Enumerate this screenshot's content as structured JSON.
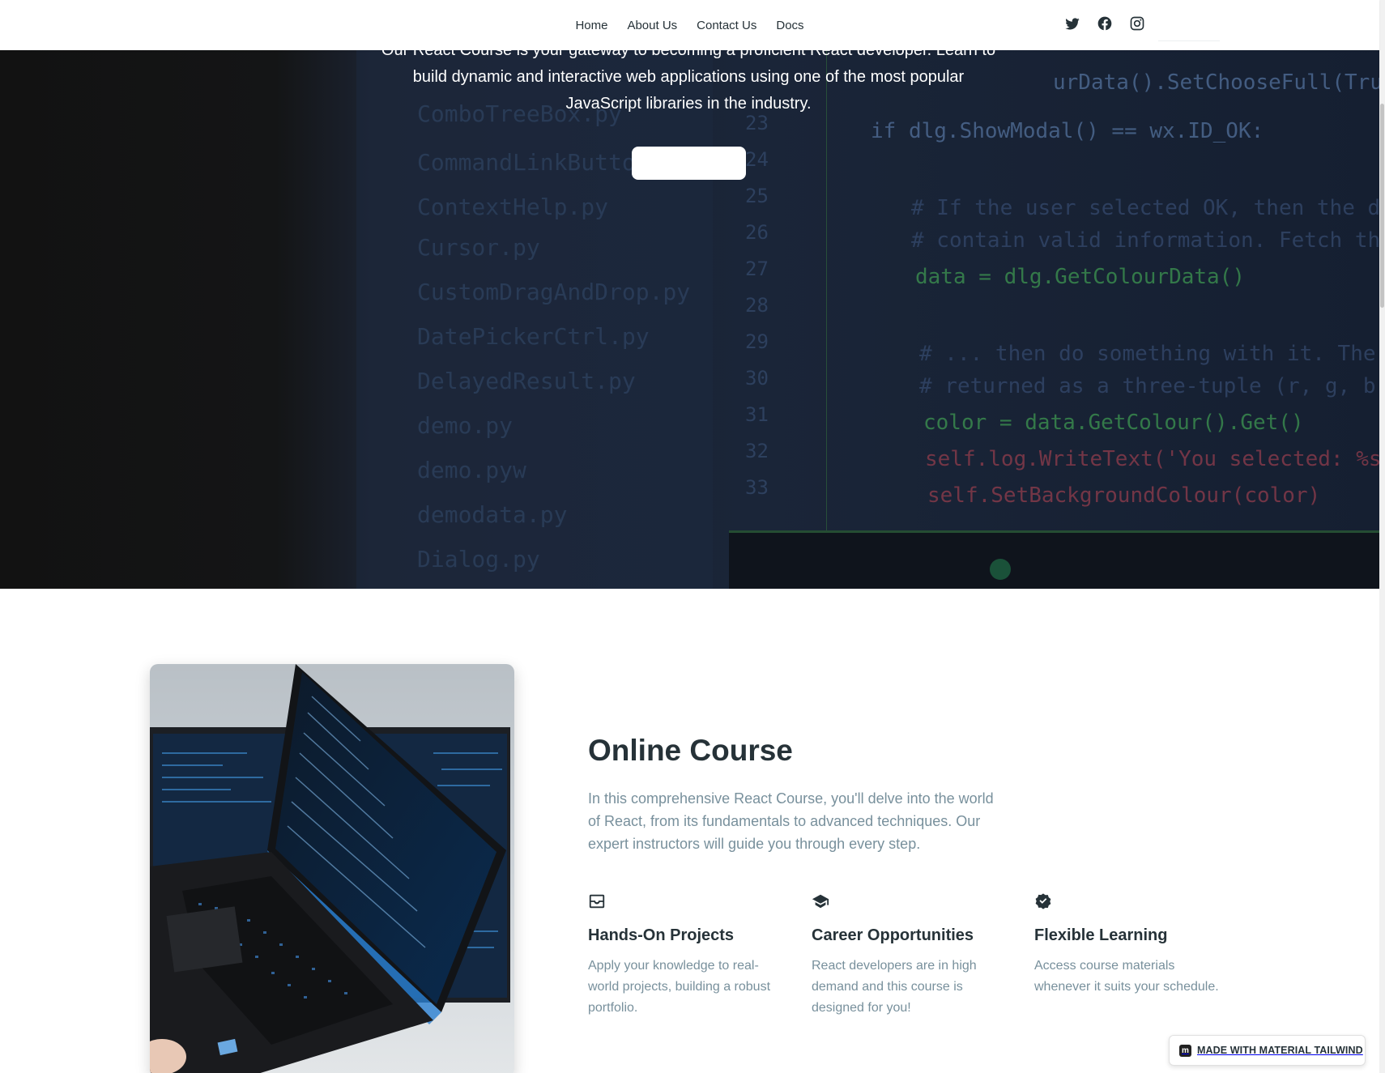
{
  "nav": {
    "links": [
      "Home",
      "About Us",
      "Contact Us",
      "Docs"
    ],
    "social_icons": [
      "twitter-icon",
      "facebook-icon",
      "instagram-icon"
    ]
  },
  "hero": {
    "lines": [
      "Our React Course is your gateway to becoming a proficient React developer. Learn to",
      "build dynamic and interactive web applications using one of the most popular",
      "JavaScript libraries in the industry."
    ],
    "button_label": ""
  },
  "course": {
    "title": "Online Course",
    "description": "In this comprehensive React Course, you'll delve into the world of React, from its fundamentals to advanced techniques. Our expert instructors will guide you through every step.",
    "features": [
      {
        "icon": "inbox-icon",
        "title": "Hands-On Projects",
        "description": "Apply your knowledge to real-world projects, building a robust portfolio."
      },
      {
        "icon": "graduation-cap-icon",
        "title": "Career Opportunities",
        "description": "React developers are in high demand and this course is designed for you!"
      },
      {
        "icon": "check-badge-icon",
        "title": "Flexible Learning",
        "description": "Access course materials whenever it suits your schedule."
      }
    ]
  },
  "badge": {
    "logo_letter": "m",
    "label": "MADE WITH MATERIAL TAILWIND"
  },
  "colors": {
    "text_dark": "#263238",
    "text_muted": "#78909c",
    "hero_overlay": "#0b1220"
  }
}
